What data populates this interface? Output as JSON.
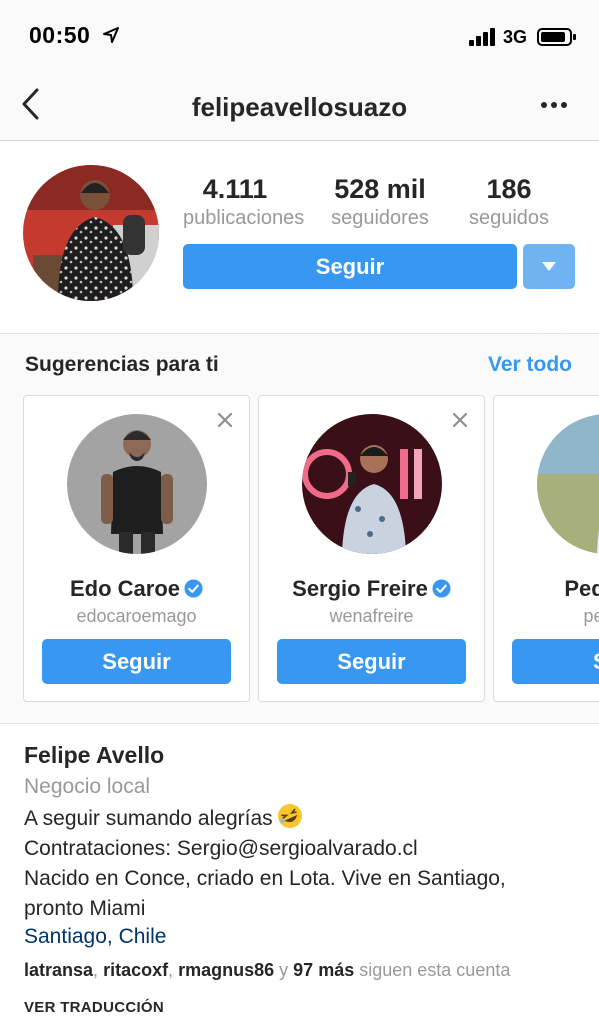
{
  "status_bar": {
    "time": "00:50",
    "network": "3G"
  },
  "nav": {
    "title": "felipeavellosuazo"
  },
  "profile": {
    "stats": [
      {
        "value": "4.111",
        "label": "publicaciones"
      },
      {
        "value": "528 mil",
        "label": "seguidores"
      },
      {
        "value": "186",
        "label": "seguidos"
      }
    ],
    "follow_label": "Seguir"
  },
  "suggestions": {
    "title": "Sugerencias para ti",
    "see_all": "Ver todo",
    "cards": [
      {
        "name": "Edo Caroe",
        "username": "edocaroemago",
        "button": "Seguir",
        "verified": true
      },
      {
        "name": "Sergio Freire",
        "username": "wenafreire",
        "button": "Seguir",
        "verified": true
      },
      {
        "name": "Pedro R",
        "username": "pedro",
        "button": "Se",
        "verified": false
      }
    ]
  },
  "bio": {
    "name": "Felipe Avello",
    "category": "Negocio local",
    "line1": "A seguir sumando alegrías",
    "line2": "Contrataciones: Sergio@sergioalvarado.cl",
    "line3": "Nacido en Conce, criado en Lota. Vive en Santiago,",
    "line4": "pronto Miami",
    "location": "Santiago, Chile",
    "followed_by": {
      "user1": "latransa",
      "sep1": ", ",
      "user2": "ritacoxf",
      "sep2": ", ",
      "user3": "rmagnus86",
      "conj": " y ",
      "more": "97 más",
      "suffix": " siguen esta cuenta"
    },
    "translate": "VER TRADUCCIÓN"
  },
  "colors": {
    "accent": "#3897f0",
    "accent_light": "#6fb3f3",
    "link": "#003569",
    "muted": "#999999",
    "verified": "#3897f0"
  },
  "icons": [
    "location-arrow-icon",
    "signal-icon",
    "battery-icon",
    "back-chevron-icon",
    "more-dots-icon",
    "dropdown-caret-icon",
    "close-icon",
    "verified-badge-icon",
    "rofl-emoji-icon"
  ]
}
